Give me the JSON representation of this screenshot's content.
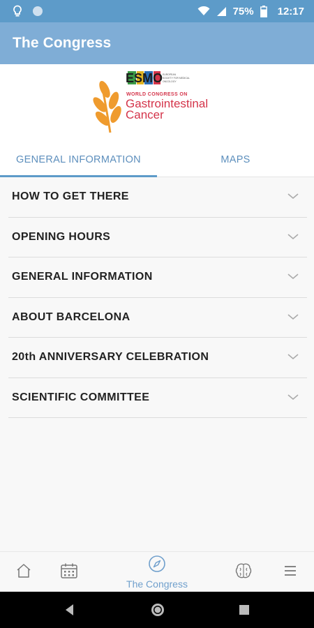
{
  "status_bar": {
    "battery": "75%",
    "time": "12:17",
    "icons": [
      "bulb-icon",
      "circle-icon",
      "wifi-icon",
      "signal-icon",
      "battery-icon"
    ]
  },
  "app_bar": {
    "title": "The Congress"
  },
  "banner": {
    "logo_esmo": "ESMO",
    "esmo_tagline": "EUROPEAN SOCIETY FOR MEDICAL ONCOLOGY",
    "subtitle": "WORLD CONGRESS ON",
    "title_line1": "Gastrointestinal",
    "title_line2": "Cancer",
    "accent_color": "#d4344a",
    "wheat_color": "#ef9b2e"
  },
  "tabs": [
    {
      "label": "GENERAL INFORMATION",
      "active": true
    },
    {
      "label": "MAPS",
      "active": false
    }
  ],
  "accordion": {
    "items": [
      {
        "label": "HOW TO GET THERE"
      },
      {
        "label": "OPENING HOURS"
      },
      {
        "label": "GENERAL INFORMATION"
      },
      {
        "label": "ABOUT BARCELONA"
      },
      {
        "label": "20th ANNIVERSARY CELEBRATION"
      },
      {
        "label": "SCIENTIFIC COMMITTEE"
      }
    ]
  },
  "bottom_nav": {
    "active_label": "The Congress",
    "icons": [
      "home-icon",
      "calendar-icon",
      "compass-icon",
      "brain-icon",
      "menu-icon"
    ]
  },
  "colors": {
    "primary": "#5d9bc9",
    "app_bar": "#7fadd6"
  }
}
